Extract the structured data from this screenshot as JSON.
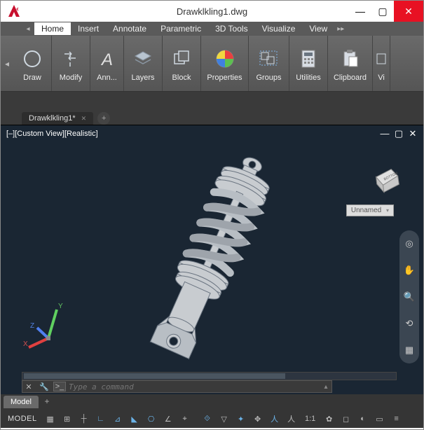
{
  "window": {
    "title": "Drawklkling1.dwg",
    "logo_text": "A",
    "minimize": "—",
    "maximize": "▢",
    "close": "✕"
  },
  "menubar": {
    "tabs": [
      "Home",
      "Insert",
      "Annotate",
      "Parametric",
      "3D Tools",
      "Visualize",
      "View"
    ],
    "active_index": 0,
    "overflow": "▸▸"
  },
  "ribbon": {
    "panels": [
      {
        "label": "Draw",
        "icon": "circle-icon"
      },
      {
        "label": "Modify",
        "icon": "move-icon"
      },
      {
        "label": "Ann...",
        "icon": "text-icon"
      },
      {
        "label": "Layers",
        "icon": "layers-icon"
      },
      {
        "label": "Block",
        "icon": "block-icon"
      },
      {
        "label": "Properties",
        "icon": "palette-icon"
      },
      {
        "label": "Groups",
        "icon": "group-icon"
      },
      {
        "label": "Utilities",
        "icon": "calc-icon"
      },
      {
        "label": "Clipboard",
        "icon": "paste-icon"
      },
      {
        "label": "Vi",
        "icon": "more-icon"
      }
    ]
  },
  "doc_tabs": {
    "tabs": [
      {
        "label": "Drawklkling1*"
      }
    ],
    "add": "+"
  },
  "viewport": {
    "label": "[–][Custom View][Realistic]",
    "unnamed": "Unnamed",
    "axes": {
      "x": "X",
      "y": "Y",
      "z": "Z"
    },
    "viewcube_face": "BOTTOM"
  },
  "command": {
    "placeholder": "Type a command",
    "prompt": ">_"
  },
  "model_tabs": {
    "active": "Model",
    "add": "+"
  },
  "statusbar": {
    "model": "MODEL",
    "scale": "1:1"
  }
}
